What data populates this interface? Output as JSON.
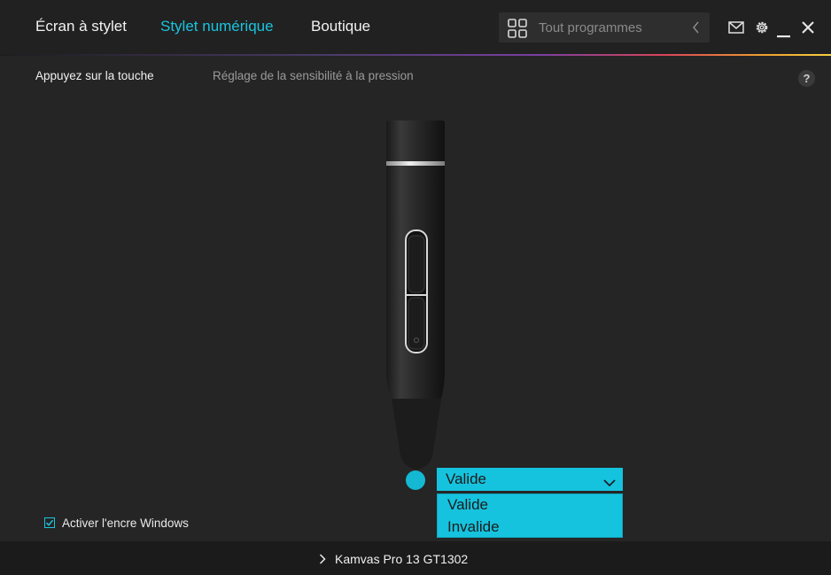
{
  "nav": {
    "tabs": [
      {
        "label": "Écran à stylet",
        "active": false
      },
      {
        "label": "Stylet numérique",
        "active": true
      },
      {
        "label": "Boutique",
        "active": false
      }
    ]
  },
  "search": {
    "placeholder": "Tout programmes",
    "icon": "app-grid-icon"
  },
  "toolbar_icons": [
    "mail-icon",
    "gear-icon",
    "minimize-icon",
    "close-icon"
  ],
  "subtabs": [
    {
      "label": "Appuyez sur la touche",
      "active": true
    },
    {
      "label": "Réglage de la sensibilité à la pression",
      "active": false
    }
  ],
  "help": {
    "label": "?"
  },
  "pen_tip": {
    "selected": "Valide",
    "options": [
      "Valide",
      "Invalide"
    ]
  },
  "windows_ink": {
    "label": "Activer l'encre Windows",
    "checked": true
  },
  "device": {
    "name": "Kamvas Pro 13 GT1302"
  },
  "colors": {
    "accent": "#19c4df",
    "background": "#252525",
    "topbar": "#212121",
    "bottombar": "#1b1b1b"
  }
}
